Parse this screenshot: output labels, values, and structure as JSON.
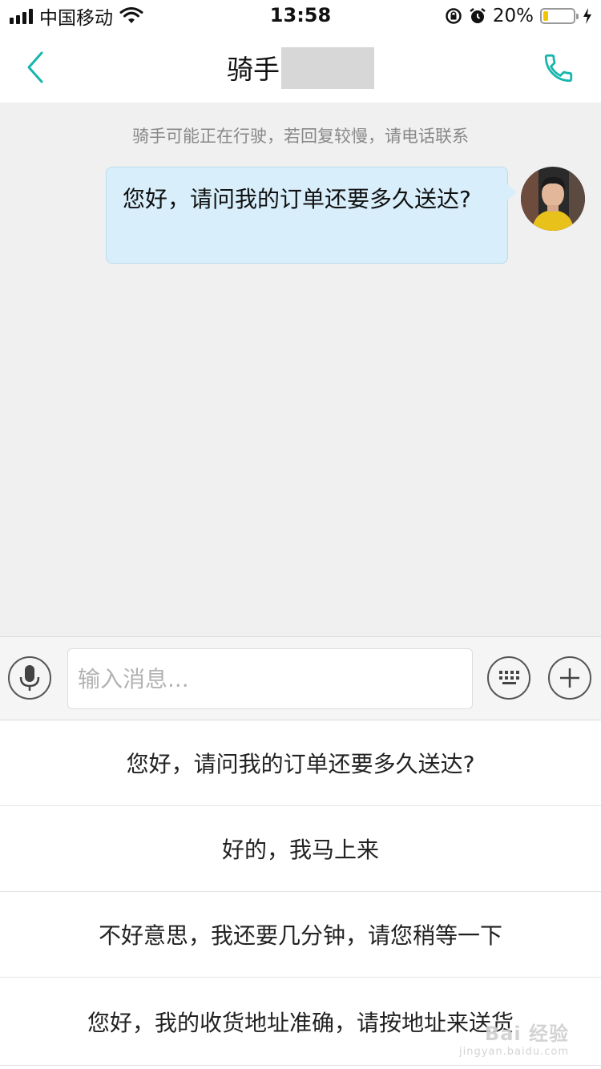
{
  "status_bar": {
    "carrier": "中国移动",
    "time": "13:58",
    "battery_percent_label": "20%",
    "battery_level": 0.2,
    "battery_color": "#f5c400"
  },
  "nav": {
    "title": "骑手",
    "back_icon": "chevron-left-icon",
    "call_icon": "phone-icon",
    "accent_color": "#16b6ac"
  },
  "chat": {
    "notice": "骑手可能正在行驶，若回复较慢，请电话联系",
    "messages": [
      {
        "text": "您好，请问我的订单还要多久送达?",
        "from": "me"
      }
    ]
  },
  "input": {
    "placeholder": "输入消息...",
    "value": ""
  },
  "quick_replies": [
    "您好，请问我的订单还要多久送达?",
    "好的，我马上来",
    "不好意思，我还要几分钟，请您稍等一下",
    "您好，我的收货地址准确，请按地址来送货"
  ],
  "watermark": {
    "main": "Bai 经验",
    "sub": "jingyan.baidu.com"
  }
}
